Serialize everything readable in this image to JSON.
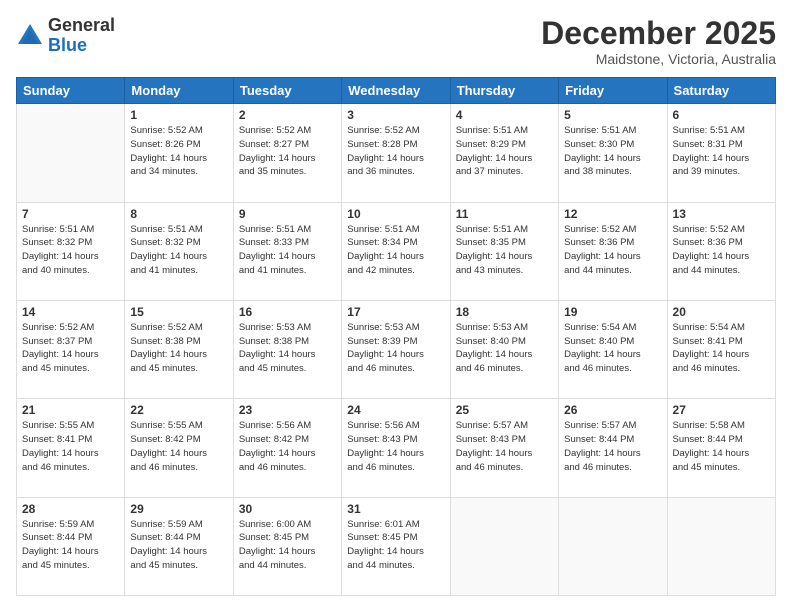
{
  "logo": {
    "general": "General",
    "blue": "Blue"
  },
  "header": {
    "title": "December 2025",
    "subtitle": "Maidstone, Victoria, Australia"
  },
  "weekdays": [
    "Sunday",
    "Monday",
    "Tuesday",
    "Wednesday",
    "Thursday",
    "Friday",
    "Saturday"
  ],
  "weeks": [
    [
      {
        "day": "",
        "info": ""
      },
      {
        "day": "1",
        "info": "Sunrise: 5:52 AM\nSunset: 8:26 PM\nDaylight: 14 hours\nand 34 minutes."
      },
      {
        "day": "2",
        "info": "Sunrise: 5:52 AM\nSunset: 8:27 PM\nDaylight: 14 hours\nand 35 minutes."
      },
      {
        "day": "3",
        "info": "Sunrise: 5:52 AM\nSunset: 8:28 PM\nDaylight: 14 hours\nand 36 minutes."
      },
      {
        "day": "4",
        "info": "Sunrise: 5:51 AM\nSunset: 8:29 PM\nDaylight: 14 hours\nand 37 minutes."
      },
      {
        "day": "5",
        "info": "Sunrise: 5:51 AM\nSunset: 8:30 PM\nDaylight: 14 hours\nand 38 minutes."
      },
      {
        "day": "6",
        "info": "Sunrise: 5:51 AM\nSunset: 8:31 PM\nDaylight: 14 hours\nand 39 minutes."
      }
    ],
    [
      {
        "day": "7",
        "info": "Sunrise: 5:51 AM\nSunset: 8:32 PM\nDaylight: 14 hours\nand 40 minutes."
      },
      {
        "day": "8",
        "info": "Sunrise: 5:51 AM\nSunset: 8:32 PM\nDaylight: 14 hours\nand 41 minutes."
      },
      {
        "day": "9",
        "info": "Sunrise: 5:51 AM\nSunset: 8:33 PM\nDaylight: 14 hours\nand 41 minutes."
      },
      {
        "day": "10",
        "info": "Sunrise: 5:51 AM\nSunset: 8:34 PM\nDaylight: 14 hours\nand 42 minutes."
      },
      {
        "day": "11",
        "info": "Sunrise: 5:51 AM\nSunset: 8:35 PM\nDaylight: 14 hours\nand 43 minutes."
      },
      {
        "day": "12",
        "info": "Sunrise: 5:52 AM\nSunset: 8:36 PM\nDaylight: 14 hours\nand 44 minutes."
      },
      {
        "day": "13",
        "info": "Sunrise: 5:52 AM\nSunset: 8:36 PM\nDaylight: 14 hours\nand 44 minutes."
      }
    ],
    [
      {
        "day": "14",
        "info": "Sunrise: 5:52 AM\nSunset: 8:37 PM\nDaylight: 14 hours\nand 45 minutes."
      },
      {
        "day": "15",
        "info": "Sunrise: 5:52 AM\nSunset: 8:38 PM\nDaylight: 14 hours\nand 45 minutes."
      },
      {
        "day": "16",
        "info": "Sunrise: 5:53 AM\nSunset: 8:38 PM\nDaylight: 14 hours\nand 45 minutes."
      },
      {
        "day": "17",
        "info": "Sunrise: 5:53 AM\nSunset: 8:39 PM\nDaylight: 14 hours\nand 46 minutes."
      },
      {
        "day": "18",
        "info": "Sunrise: 5:53 AM\nSunset: 8:40 PM\nDaylight: 14 hours\nand 46 minutes."
      },
      {
        "day": "19",
        "info": "Sunrise: 5:54 AM\nSunset: 8:40 PM\nDaylight: 14 hours\nand 46 minutes."
      },
      {
        "day": "20",
        "info": "Sunrise: 5:54 AM\nSunset: 8:41 PM\nDaylight: 14 hours\nand 46 minutes."
      }
    ],
    [
      {
        "day": "21",
        "info": "Sunrise: 5:55 AM\nSunset: 8:41 PM\nDaylight: 14 hours\nand 46 minutes."
      },
      {
        "day": "22",
        "info": "Sunrise: 5:55 AM\nSunset: 8:42 PM\nDaylight: 14 hours\nand 46 minutes."
      },
      {
        "day": "23",
        "info": "Sunrise: 5:56 AM\nSunset: 8:42 PM\nDaylight: 14 hours\nand 46 minutes."
      },
      {
        "day": "24",
        "info": "Sunrise: 5:56 AM\nSunset: 8:43 PM\nDaylight: 14 hours\nand 46 minutes."
      },
      {
        "day": "25",
        "info": "Sunrise: 5:57 AM\nSunset: 8:43 PM\nDaylight: 14 hours\nand 46 minutes."
      },
      {
        "day": "26",
        "info": "Sunrise: 5:57 AM\nSunset: 8:44 PM\nDaylight: 14 hours\nand 46 minutes."
      },
      {
        "day": "27",
        "info": "Sunrise: 5:58 AM\nSunset: 8:44 PM\nDaylight: 14 hours\nand 45 minutes."
      }
    ],
    [
      {
        "day": "28",
        "info": "Sunrise: 5:59 AM\nSunset: 8:44 PM\nDaylight: 14 hours\nand 45 minutes."
      },
      {
        "day": "29",
        "info": "Sunrise: 5:59 AM\nSunset: 8:44 PM\nDaylight: 14 hours\nand 45 minutes."
      },
      {
        "day": "30",
        "info": "Sunrise: 6:00 AM\nSunset: 8:45 PM\nDaylight: 14 hours\nand 44 minutes."
      },
      {
        "day": "31",
        "info": "Sunrise: 6:01 AM\nSunset: 8:45 PM\nDaylight: 14 hours\nand 44 minutes."
      },
      {
        "day": "",
        "info": ""
      },
      {
        "day": "",
        "info": ""
      },
      {
        "day": "",
        "info": ""
      }
    ]
  ]
}
